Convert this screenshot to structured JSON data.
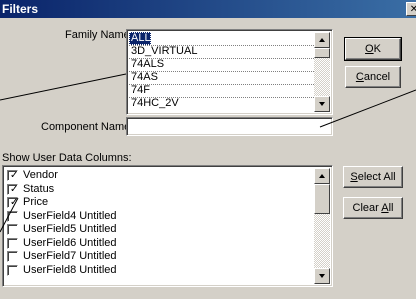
{
  "window": {
    "title": "Filters",
    "close_glyph": "✕"
  },
  "family": {
    "label": "Family Name:",
    "items": [
      "ALL",
      "3D_VIRTUAL",
      "74ALS",
      "74AS",
      "74F",
      "74HC_2V"
    ],
    "selected": "ALL"
  },
  "component": {
    "label": "Component Name:",
    "value": ""
  },
  "buttons": {
    "ok_accel": "O",
    "ok_rest": "K",
    "cancel_accel": "C",
    "cancel_rest": "ancel",
    "select_all_accel": "S",
    "select_all_rest": "elect All",
    "clear_all_pre": "Clear ",
    "clear_all_accel": "A",
    "clear_all_rest": "ll"
  },
  "user_columns": {
    "label": "Show User Data Columns:",
    "items": [
      {
        "label": "Vendor",
        "checked": true
      },
      {
        "label": "Status",
        "checked": true
      },
      {
        "label": "Price",
        "checked": true
      },
      {
        "label": "UserField4 Untitled",
        "checked": false
      },
      {
        "label": "UserField5 Untitled",
        "checked": false
      },
      {
        "label": "UserField6 Untitled",
        "checked": false
      },
      {
        "label": "UserField7 Untitled",
        "checked": false
      },
      {
        "label": "UserField8 Untitled",
        "checked": false
      }
    ],
    "check_glyph": "✓"
  }
}
